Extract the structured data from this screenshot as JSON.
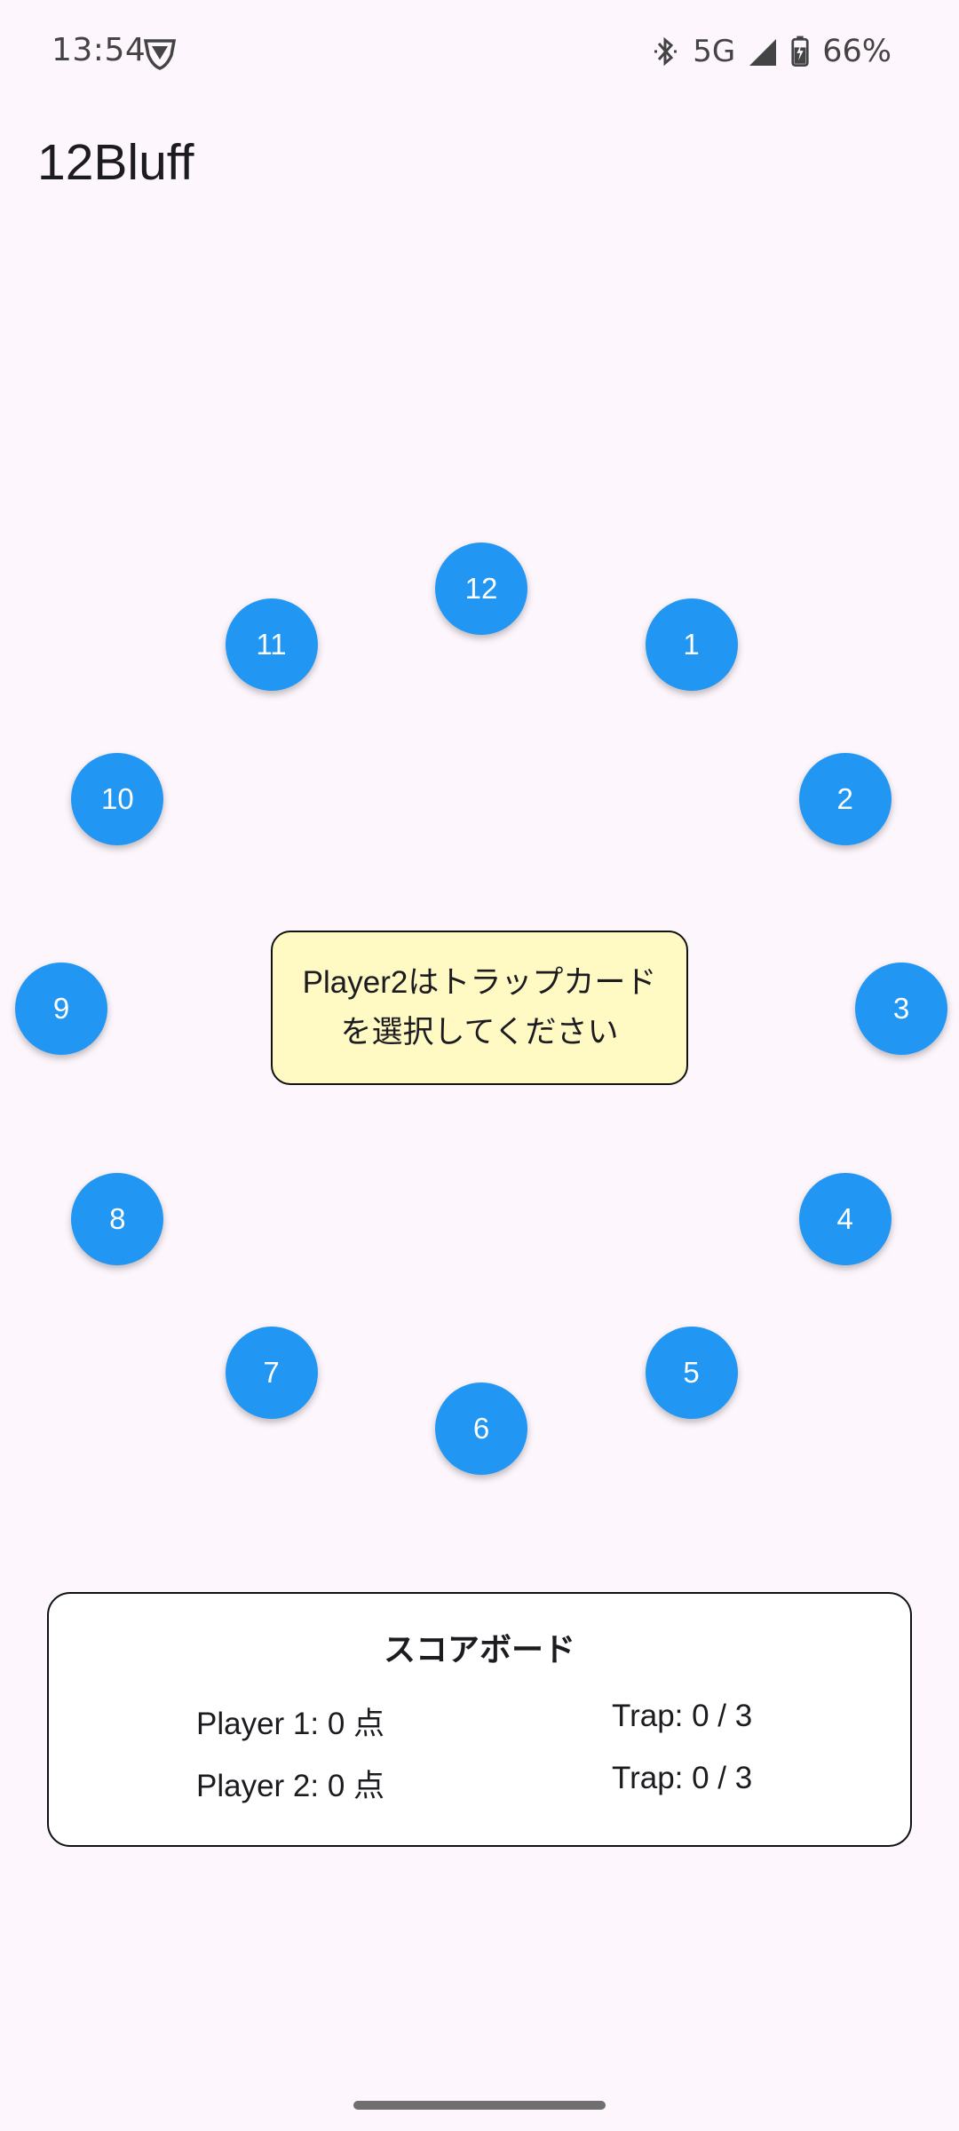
{
  "status_bar": {
    "time": "13:54",
    "network": "5G",
    "battery": "66%"
  },
  "app": {
    "title": "12Bluff"
  },
  "dial": {
    "button_color": "#2196f3",
    "numbers": [
      "12",
      "1",
      "2",
      "3",
      "4",
      "5",
      "6",
      "7",
      "8",
      "9",
      "10",
      "11"
    ]
  },
  "message": {
    "text": "Player2はトラップカードを選択してください",
    "background": "#fff9c4"
  },
  "scoreboard": {
    "title": "スコアボード",
    "rows": [
      {
        "player": "Player 1: 0 点",
        "trap": "Trap: 0 / 3"
      },
      {
        "player": "Player 2: 0 点",
        "trap": "Trap: 0 / 3"
      }
    ]
  }
}
